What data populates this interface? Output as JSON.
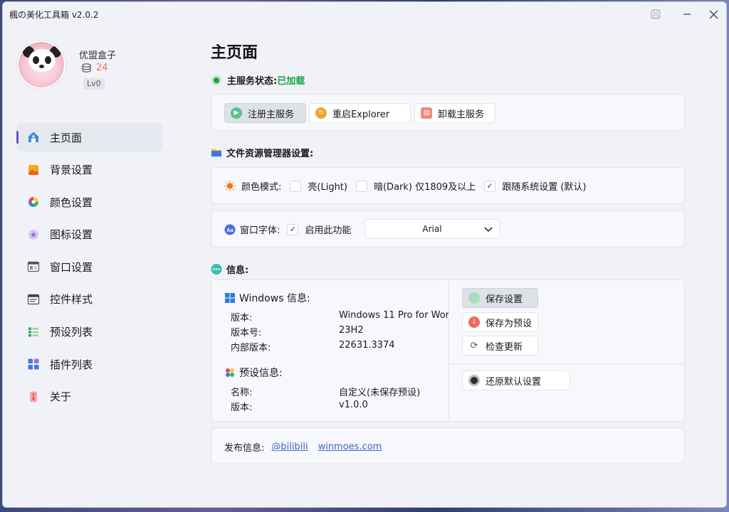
{
  "window": {
    "title": "楓の美化工具箱 v2.0.2"
  },
  "user": {
    "name": "优盟盒子",
    "coins": "24",
    "level": "Lv0"
  },
  "nav": {
    "items": [
      {
        "label": "主页面",
        "icon": "home-icon"
      },
      {
        "label": "背景设置",
        "icon": "image-icon"
      },
      {
        "label": "颜色设置",
        "icon": "palette-icon"
      },
      {
        "label": "图标设置",
        "icon": "star-icon"
      },
      {
        "label": "窗口设置",
        "icon": "window-icon"
      },
      {
        "label": "控件样式",
        "icon": "control-icon"
      },
      {
        "label": "预设列表",
        "icon": "list-icon"
      },
      {
        "label": "插件列表",
        "icon": "plugin-icon"
      },
      {
        "label": "关于",
        "icon": "info-icon"
      }
    ]
  },
  "main": {
    "title": "主页面",
    "service_status_label": "主服务状态:",
    "service_status_value": "已加载",
    "service_buttons": {
      "register": "注册主服务",
      "restart": "重启Explorer",
      "uninstall": "卸载主服务"
    },
    "explorer_section_title": "文件资源管理器设置:",
    "color_mode": {
      "label": "颜色模式:",
      "light": "亮(Light)",
      "dark": "暗(Dark) 仅1809及以上",
      "system": "跟随系统设置 (默认)"
    },
    "window_font": {
      "label": "窗口字体:",
      "enable_label": "启用此功能",
      "font_value": "Arial"
    },
    "info_section_title": "信息:",
    "windows_info": {
      "header": "Windows 信息:",
      "rows": [
        {
          "key": "版本:",
          "value": "Windows 11 Pro for Wor"
        },
        {
          "key": "版本号:",
          "value": "23H2"
        },
        {
          "key": "内部版本:",
          "value": "22631.3374"
        }
      ]
    },
    "preset_info": {
      "header": "预设信息:",
      "rows": [
        {
          "key": "名称:",
          "value": "自定义(未保存预设)"
        },
        {
          "key": "版本:",
          "value": "v1.0.0"
        }
      ]
    },
    "info_buttons": {
      "save": "保存设置",
      "save_preset": "保存为预设",
      "check_update": "检查更新",
      "restore_default": "还原默认设置"
    },
    "publish": {
      "label": "发布信息:",
      "bilibili": "@bilibili",
      "site": "winmoes.com"
    }
  },
  "colors": {
    "accent": "#6b55b8",
    "status_green": "#16a34a",
    "coin_orange": "#ea7a4f",
    "link_blue": "#3b64c8"
  }
}
